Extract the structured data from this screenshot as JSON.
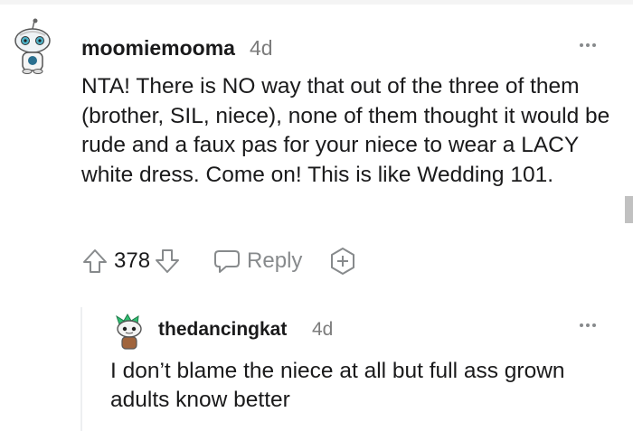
{
  "comment": {
    "username": "moomiemooma",
    "age": "4d",
    "text": "NTA! There is NO way that out of the three of them (brother, SIL, niece), none of them thought it would be rude and a faux pas for your niece to wear a LACY white dress. Come on! This is like Wedding 101.",
    "score": "378",
    "reply_label": "Reply",
    "icons": [
      "avatar",
      "upvote-icon",
      "downvote-icon",
      "reply-icon",
      "award-icon",
      "more-options-icon"
    ]
  },
  "reply": {
    "username": "thedancingkat",
    "age": "4d",
    "text": "I don’t blame the niece at all but full ass grown adults know better",
    "icons": [
      "avatar",
      "more-options-icon"
    ]
  },
  "colors": {
    "text": "#1a1a1b",
    "meta": "#7c7c7c",
    "icon": "#878a8c",
    "thread_line": "#edeff1"
  }
}
